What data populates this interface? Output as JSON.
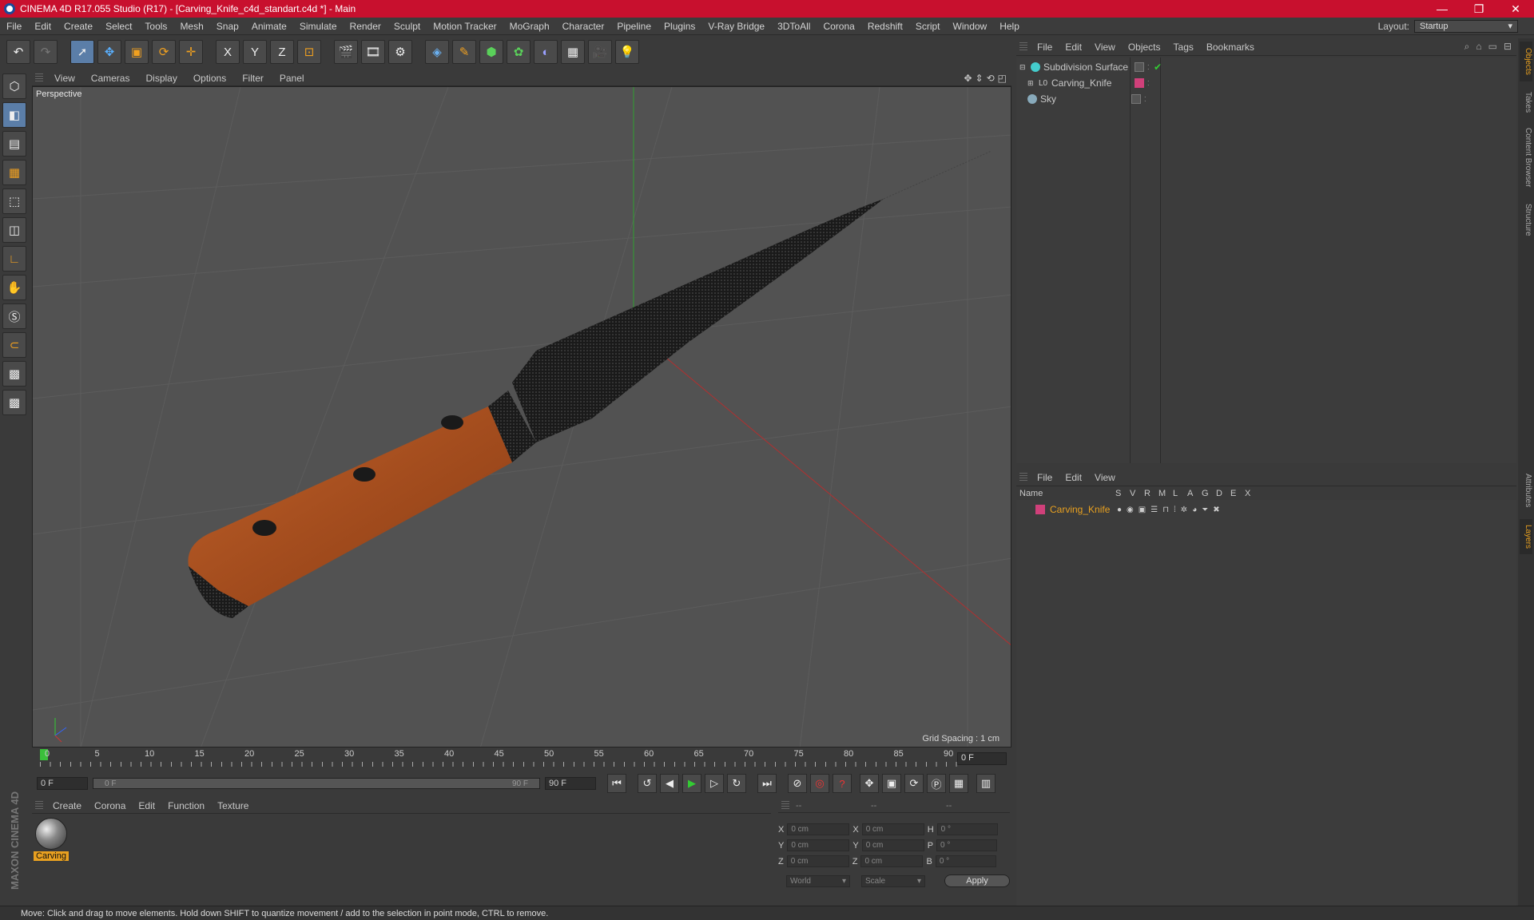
{
  "window": {
    "title": "CINEMA 4D R17.055 Studio (R17) - [Carving_Knife_c4d_standart.c4d *] - Main",
    "controls": [
      "—",
      "❐",
      "✕"
    ]
  },
  "menubar": {
    "items": [
      "File",
      "Edit",
      "Create",
      "Select",
      "Tools",
      "Mesh",
      "Snap",
      "Animate",
      "Simulate",
      "Render",
      "Sculpt",
      "Motion Tracker",
      "MoGraph",
      "Character",
      "Pipeline",
      "Plugins",
      "V-Ray Bridge",
      "3DToAll",
      "Corona",
      "Redshift",
      "Script",
      "Window",
      "Help"
    ],
    "layout_label": "Layout:",
    "layout_value": "Startup"
  },
  "toolbar": {
    "icons": [
      "undo-icon",
      "redo-icon",
      "select-icon",
      "move-icon",
      "scale-icon",
      "rotate-icon",
      "move-tool-icon",
      "x-axis-icon",
      "y-axis-icon",
      "z-axis-icon",
      "coordinate-system-icon",
      "render-view-icon",
      "render-icon",
      "render-settings-icon",
      "cube-icon",
      "pen-icon",
      "subdivision-icon",
      "array-icon",
      "deformer-icon",
      "floor-icon",
      "camera-icon",
      "light-icon"
    ],
    "axis_labels": [
      "X",
      "Y",
      "Z"
    ]
  },
  "left_tools": [
    "model-mode-icon",
    "texture-mode-icon",
    "workplane-icon",
    "points-mode-icon",
    "edges-mode-icon",
    "polygons-mode-icon",
    "axis-icon",
    "tweak-icon",
    "snap-s-icon",
    "magnet-icon",
    "lock-workplane-icon",
    "grid-snap-icon"
  ],
  "viewport": {
    "menu": [
      "View",
      "Cameras",
      "Display",
      "Options",
      "Filter",
      "Panel"
    ],
    "label": "Perspective",
    "grid_spacing": "Grid Spacing : 1 cm"
  },
  "timeline": {
    "ticks": [
      "0",
      "5",
      "10",
      "15",
      "20",
      "25",
      "30",
      "35",
      "40",
      "45",
      "50",
      "55",
      "60",
      "65",
      "70",
      "75",
      "80",
      "85",
      "90"
    ],
    "current_frame": "0 F",
    "start_field": "0 F",
    "range_start": "0 F",
    "range_end": "90 F",
    "end_field": "90 F"
  },
  "material_manager": {
    "menu": [
      "Create",
      "Corona",
      "Edit",
      "Function",
      "Texture"
    ],
    "materials": [
      {
        "name": "Carving"
      }
    ]
  },
  "coordinates": {
    "header": [
      "--",
      "--",
      "--"
    ],
    "rows": [
      {
        "a": "X",
        "av": "0 cm",
        "b": "X",
        "bv": "0 cm",
        "c": "H",
        "cv": "0 °"
      },
      {
        "a": "Y",
        "av": "0 cm",
        "b": "Y",
        "bv": "0 cm",
        "c": "P",
        "cv": "0 °"
      },
      {
        "a": "Z",
        "av": "0 cm",
        "b": "Z",
        "bv": "0 cm",
        "c": "B",
        "cv": "0 °"
      }
    ],
    "space": "World",
    "mode": "Scale",
    "apply": "Apply"
  },
  "object_manager": {
    "menu": [
      "File",
      "Edit",
      "View",
      "Objects",
      "Tags",
      "Bookmarks"
    ],
    "objects": [
      {
        "name": "Subdivision Surface",
        "color": "#3a3a3a",
        "check": "✔"
      },
      {
        "name": "Carving_Knife",
        "color": "#d0407a",
        "check": ""
      },
      {
        "name": "Sky",
        "color": "#3a3a3a",
        "check": ""
      }
    ]
  },
  "layer_manager": {
    "menu": [
      "File",
      "Edit",
      "View"
    ],
    "columns": [
      "Name",
      "S",
      "V",
      "R",
      "M",
      "L",
      "A",
      "G",
      "D",
      "E",
      "X"
    ],
    "layers": [
      {
        "name": "Carving_Knife",
        "color": "#d0407a"
      }
    ]
  },
  "side_tabs": [
    "Objects",
    "Takes",
    "Content Browser",
    "Structure",
    "Attributes",
    "Layers"
  ],
  "branding": "MAXON CINEMA 4D",
  "statusbar": "Move: Click and drag to move elements. Hold down SHIFT to quantize movement / add to the selection in point mode, CTRL to remove."
}
